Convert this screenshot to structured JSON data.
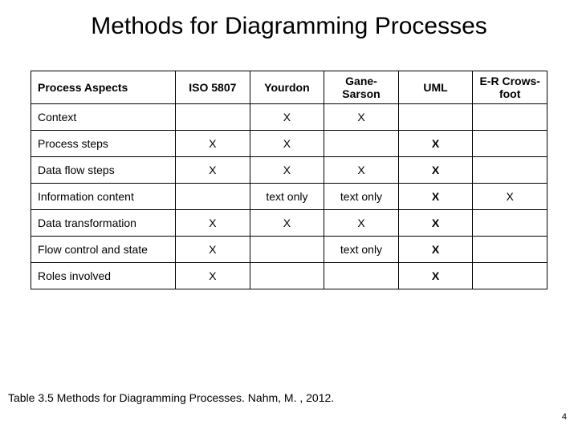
{
  "title": "Methods for Diagramming Processes",
  "table": {
    "row_header_label": "Process Aspects",
    "methods": [
      {
        "id": "iso",
        "label": "ISO 5807"
      },
      {
        "id": "yourdon",
        "label": "Yourdon"
      },
      {
        "id": "gane",
        "label": "Gane-Sarson"
      },
      {
        "id": "uml",
        "label": "UML"
      },
      {
        "id": "er",
        "label": "E-R Crows-foot"
      }
    ],
    "aspects": [
      {
        "label": "Context",
        "cells": [
          "",
          "X",
          "X",
          "",
          ""
        ]
      },
      {
        "label": "Process steps",
        "cells": [
          "X",
          "X",
          "",
          "X",
          ""
        ]
      },
      {
        "label": "Data flow steps",
        "cells": [
          "X",
          "X",
          "X",
          "X",
          ""
        ]
      },
      {
        "label": "Information content",
        "cells": [
          "",
          "text only",
          "text only",
          "X",
          "X"
        ]
      },
      {
        "label": "Data transformation",
        "cells": [
          "X",
          "X",
          "X",
          "X",
          ""
        ]
      },
      {
        "label": "Flow control and state",
        "cells": [
          "X",
          "",
          "text only",
          "X",
          ""
        ]
      },
      {
        "label": "Roles involved",
        "cells": [
          "X",
          "",
          "",
          "X",
          ""
        ]
      }
    ],
    "bold_column_index": 3
  },
  "caption": "Table 3.5   Methods for Diagramming Processes.  Nahm, M. , 2012.",
  "page_number": "4"
}
